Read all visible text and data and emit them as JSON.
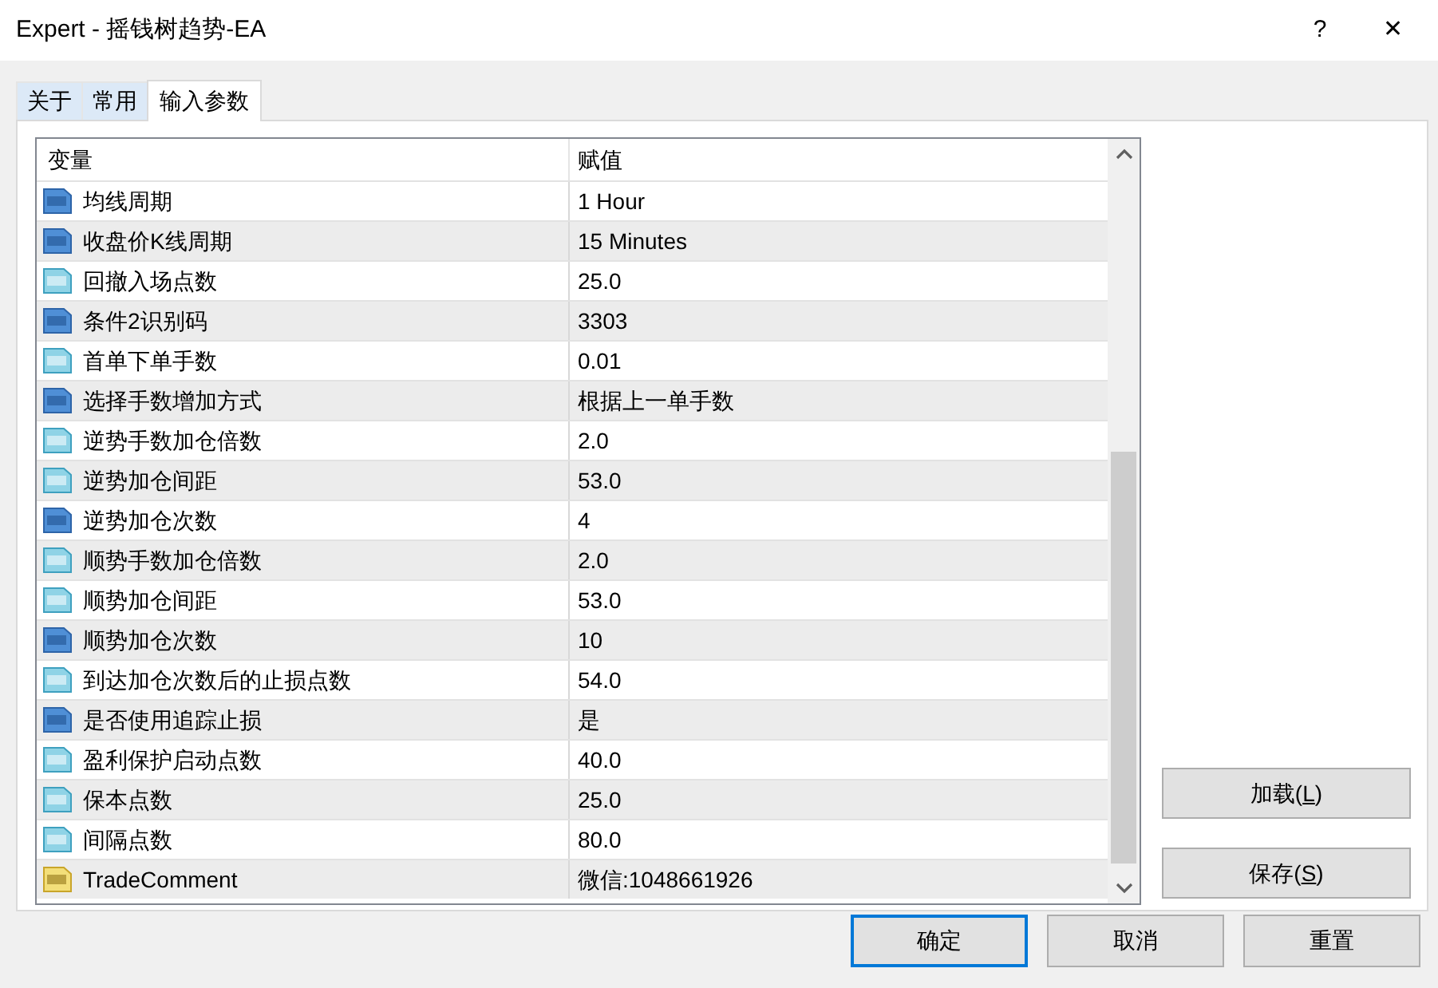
{
  "window": {
    "title": "Expert - 摇钱树趋势-EA",
    "help": "?",
    "close": "✕"
  },
  "tabs": [
    {
      "label": "关于",
      "selected": false
    },
    {
      "label": "常用",
      "selected": false
    },
    {
      "label": "输入参数",
      "selected": true
    }
  ],
  "table": {
    "columns": [
      "变量",
      "赋值"
    ],
    "rows": [
      {
        "kind": "int",
        "name": "均线周期",
        "value": "1 Hour"
      },
      {
        "kind": "int",
        "name": "收盘价K线周期",
        "value": "15 Minutes"
      },
      {
        "kind": "double",
        "name": "回撤入场点数",
        "value": "25.0"
      },
      {
        "kind": "int",
        "name": "条件2识别码",
        "value": "3303"
      },
      {
        "kind": "double",
        "name": "首单下单手数",
        "value": "0.01"
      },
      {
        "kind": "int",
        "name": "选择手数增加方式",
        "value": "根据上一单手数"
      },
      {
        "kind": "double",
        "name": "逆势手数加仓倍数",
        "value": "2.0"
      },
      {
        "kind": "double",
        "name": "逆势加仓间距",
        "value": "53.0"
      },
      {
        "kind": "int",
        "name": "逆势加仓次数",
        "value": "4"
      },
      {
        "kind": "double",
        "name": "顺势手数加仓倍数",
        "value": "2.0"
      },
      {
        "kind": "double",
        "name": "顺势加仓间距",
        "value": "53.0"
      },
      {
        "kind": "int",
        "name": "顺势加仓次数",
        "value": "10"
      },
      {
        "kind": "double",
        "name": "到达加仓次数后的止损点数",
        "value": "54.0"
      },
      {
        "kind": "int",
        "name": "是否使用追踪止损",
        "value": "是"
      },
      {
        "kind": "double",
        "name": "盈利保护启动点数",
        "value": "40.0"
      },
      {
        "kind": "double",
        "name": "保本点数",
        "value": "25.0"
      },
      {
        "kind": "double",
        "name": "间隔点数",
        "value": "80.0"
      },
      {
        "kind": "string",
        "name": "TradeComment",
        "value": "微信:1048661926"
      }
    ]
  },
  "side_buttons": [
    {
      "label": "加载(",
      "mnemonic": "L",
      "label_end": ")"
    },
    {
      "label": "保存(",
      "mnemonic": "S",
      "label_end": ")"
    }
  ],
  "buttons": [
    {
      "label": "确定",
      "default": true
    },
    {
      "label": "取消",
      "default": false
    },
    {
      "label": "重置",
      "default": false
    }
  ]
}
